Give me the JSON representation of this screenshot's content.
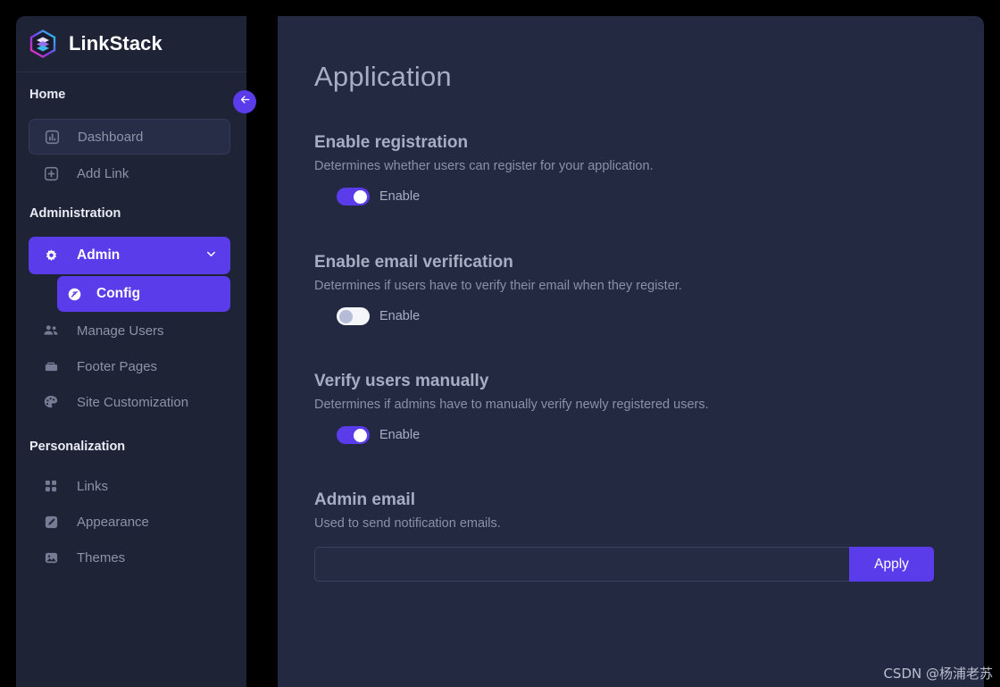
{
  "brand": {
    "name": "LinkStack",
    "logo_icon": "hexagon-layers-icon"
  },
  "sidebar": {
    "sections": [
      {
        "label": "Home"
      },
      {
        "label": "Administration"
      },
      {
        "label": "Personalization"
      }
    ],
    "home_items": [
      {
        "label": "Dashboard",
        "icon": "bar-chart-icon",
        "state": "highlighted"
      },
      {
        "label": "Add Link",
        "icon": "plus-square-icon",
        "state": "default"
      }
    ],
    "admin_items": [
      {
        "label": "Admin",
        "icon": "gear-icon",
        "state": "active",
        "chevron": "chevron-down-icon"
      },
      {
        "label": "Config",
        "icon": "config-circle-icon",
        "state": "active-sub"
      },
      {
        "label": "Manage Users",
        "icon": "people-icon",
        "state": "default"
      },
      {
        "label": "Footer Pages",
        "icon": "briefcase-icon",
        "state": "default"
      },
      {
        "label": "Site Customization",
        "icon": "palette-icon",
        "state": "default"
      }
    ],
    "personalization_items": [
      {
        "label": "Links",
        "icon": "grid-icon",
        "state": "default"
      },
      {
        "label": "Appearance",
        "icon": "pencil-square-icon",
        "state": "default"
      },
      {
        "label": "Themes",
        "icon": "image-icon",
        "state": "default"
      }
    ],
    "collapse_button": {
      "icon": "arrow-left-icon"
    }
  },
  "main": {
    "title": "Application",
    "settings": [
      {
        "title": "Enable registration",
        "description": "Determines whether users can register for your application.",
        "toggle": {
          "label": "Enable",
          "state": "on"
        }
      },
      {
        "title": "Enable email verification",
        "description": "Determines if users have to verify their email when they register.",
        "toggle": {
          "label": "Enable",
          "state": "off"
        }
      },
      {
        "title": "Verify users manually",
        "description": "Determines if admins have to manually verify newly registered users.",
        "toggle": {
          "label": "Enable",
          "state": "on"
        }
      }
    ],
    "admin_email": {
      "title": "Admin email",
      "description": "Used to send notification emails.",
      "input_value": "",
      "input_placeholder": "",
      "button_label": "Apply"
    }
  },
  "watermark": "CSDN @杨浦老苏",
  "colors": {
    "accent": "#5a3ceb",
    "sidebar_bg": "#1e2336",
    "main_bg": "#232940",
    "text_primary": "#a7aec4",
    "text_muted": "#8a90a6"
  }
}
